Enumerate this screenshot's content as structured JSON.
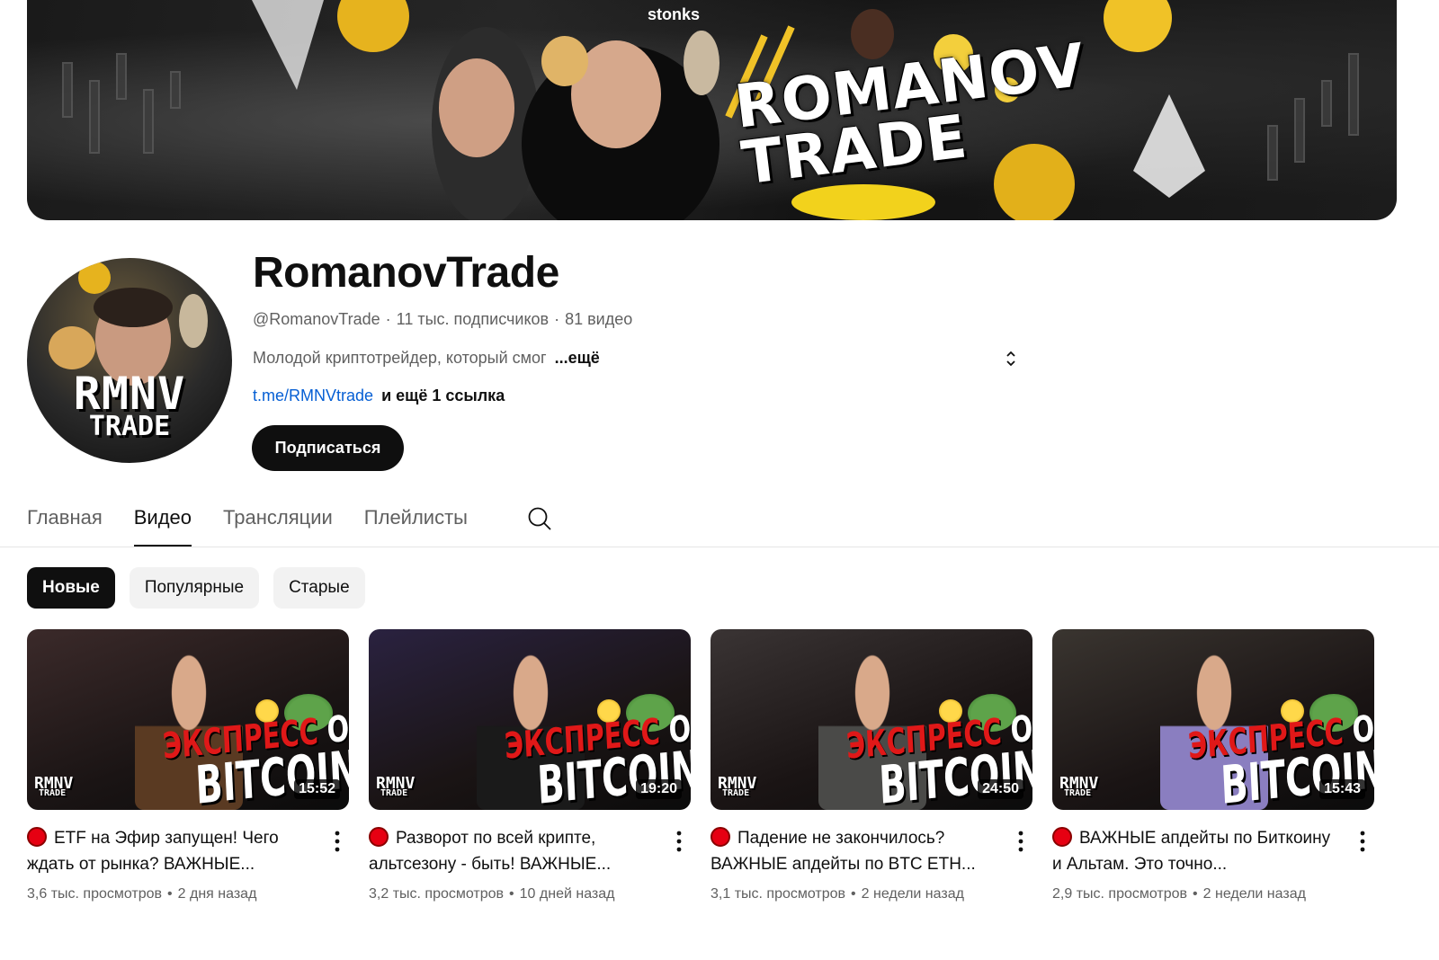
{
  "banner": {
    "caption": "stonks",
    "title_line1": "ROMANOV",
    "title_line2": "TRADE"
  },
  "avatar": {
    "logo_line1": "RMNV",
    "logo_line2": "TRADE"
  },
  "channel": {
    "name": "RomanovTrade",
    "handle": "@RomanovTrade",
    "subscribers": "11 тыс. подписчиков",
    "video_count": "81 видео",
    "description": "Молодой криптотрейдер, который смог",
    "more_label": "...ещё",
    "link": "t.me/RMNVtrade",
    "more_links": "и ещё 1 ссылка",
    "subscribe_label": "Подписаться"
  },
  "tabs": [
    {
      "label": "Главная",
      "active": false
    },
    {
      "label": "Видео",
      "active": true
    },
    {
      "label": "Трансляции",
      "active": false
    },
    {
      "label": "Плейлисты",
      "active": false
    }
  ],
  "chips": [
    {
      "label": "Новые",
      "active": true
    },
    {
      "label": "Популярные",
      "active": false
    },
    {
      "label": "Старые",
      "active": false
    }
  ],
  "thumbnail_text": {
    "line1_red": "ЭКСПРЕСС",
    "line1_white": "ОБЗОР",
    "line2": "BITCOIN",
    "brand": "RMNV",
    "brand_sub": "TRADE"
  },
  "videos": [
    {
      "title": "ETF на Эфир запущен! Чего ждать от рынка? ВАЖНЫЕ...",
      "duration": "15:52",
      "views": "3,6 тыс. просмотров",
      "age": "2 дня назад",
      "bg_color": "#3b2a2a",
      "shirt_color": "#5a3a22"
    },
    {
      "title": "Разворот по всей крипте, альтсезону - быть! ВАЖНЫЕ...",
      "duration": "19:20",
      "views": "3,2 тыс. просмотров",
      "age": "10 дней назад",
      "bg_color": "#2a2240",
      "shirt_color": "#1a1a1a"
    },
    {
      "title": "Падение не закончилось? ВАЖНЫЕ апдейты по BTC ETH...",
      "duration": "24:50",
      "views": "3,1 тыс. просмотров",
      "age": "2 недели назад",
      "bg_color": "#3a3434",
      "shirt_color": "#4a4a48"
    },
    {
      "title": "ВАЖНЫЕ апдейты по Биткоину и Альтам. Это точно...",
      "duration": "15:43",
      "views": "2,9 тыс. просмотров",
      "age": "2 недели назад",
      "bg_color": "#3a3530",
      "shirt_color": "#8a7ec0"
    }
  ],
  "icons": {
    "search": "search-icon",
    "menu": "more-vert-icon",
    "live": "live-dot-icon",
    "expand": "unfold-icon"
  },
  "colors": {
    "link": "#065fd4",
    "live_red": "#e60012",
    "dark": "#0f0f0f"
  }
}
